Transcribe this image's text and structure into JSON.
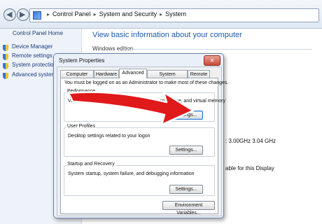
{
  "address_bar": {
    "breadcrumbs": [
      "Control Panel",
      "System and Security",
      "System"
    ],
    "separator": "▸"
  },
  "left_pane": {
    "home": "Control Panel Home",
    "tasks": [
      "Device Manager",
      "Remote settings",
      "System protection",
      "Advanced system"
    ]
  },
  "main": {
    "title": "View basic information about your computer",
    "section": "Windows edition",
    "processor_speed": ": 3.00GHz   3.04 GHz",
    "pen_touch": "able for this Display"
  },
  "dialog": {
    "title": "System Properties",
    "close": "✕",
    "tabs": [
      "Computer Name",
      "Hardware",
      "Advanced",
      "System Protection",
      "Remote"
    ],
    "active_tab": "Advanced",
    "admin_note": "You must be logged on as an Administrator to make most of these changes.",
    "performance": {
      "title": "Performance",
      "desc": "Visual effects, processor scheduling, memory usage, and virtual memory",
      "button": "Settings..."
    },
    "user_profiles": {
      "title": "User Profiles",
      "desc": "Desktop settings related to your logon",
      "button": "Settings..."
    },
    "startup": {
      "title": "Startup and Recovery",
      "desc": "System startup, system failure, and debugging information",
      "button": "Settings..."
    },
    "env_button": "Environment Variables..."
  },
  "overlay": {
    "arrow_color": "#e0191b"
  }
}
